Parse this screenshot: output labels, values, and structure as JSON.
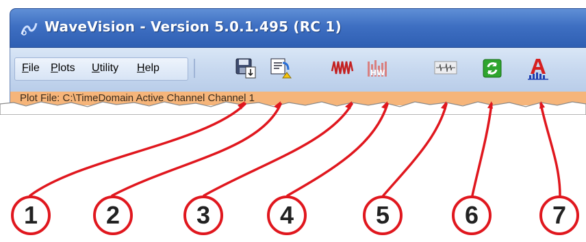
{
  "window": {
    "title": "WaveVision - Version 5.0.1.495 (RC 1)"
  },
  "menu": {
    "items": [
      "File",
      "Plots",
      "Utility",
      "Help"
    ]
  },
  "toolbar": {
    "buttons": [
      {
        "icon": "save-data-icon",
        "callout": "1"
      },
      {
        "icon": "load-data-icon",
        "callout": "2"
      },
      {
        "icon": "time-domain-icon",
        "callout": "3"
      },
      {
        "icon": "histogram-icon",
        "callout": "4"
      },
      {
        "icon": "fft-icon",
        "callout": "5"
      },
      {
        "icon": "refresh-icon",
        "callout": "6"
      },
      {
        "icon": "analysis-icon",
        "callout": "7"
      }
    ]
  },
  "status": {
    "text": "Plot File: C:\\TimeDomain Active Channel Channel 1"
  },
  "colors": {
    "titlebar": "#3e6fc2",
    "menustrip": "#c7d8ef",
    "status_bar": "#f6b57a",
    "callout": "#e0171e"
  }
}
